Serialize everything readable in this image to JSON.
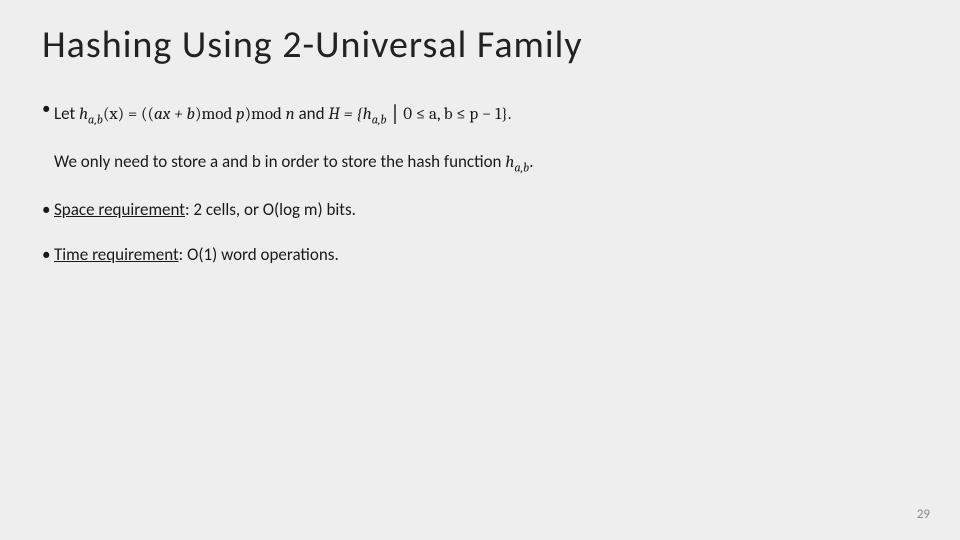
{
  "title": "Hashing Using 2-Universal Family",
  "bullet_char": "•",
  "line1": {
    "let": "Let ",
    "h_fn": "h",
    "h_sub": "a,b",
    "x_open": "(x) = ",
    "big_open": "(",
    "inner_open": "(",
    "ax_b": "ax + b",
    "inner_close": ")",
    "mod1": "mod ",
    "p": "p",
    "big_close": ")",
    "mod2": "mod ",
    "n": "n",
    "and_text": " and ",
    "H_eq": "H = {",
    "h_fn2": "h",
    "h_sub2": "a,b",
    "bar": " | ",
    "range": "0 ≤ a, b ≤ p − 1",
    "close_brace": "}.",
    "store_text": "We only need to store a and b in order to store the hash function ",
    "h_fn3": "h",
    "h_sub3": "a,b",
    "dot": "."
  },
  "space_req_label": "Space requirement",
  "space_req_text": ": 2 cells, or O(log m) bits.",
  "time_req_label": "Time requirement",
  "time_req_text": ": O(1) word operations.",
  "page_number": "29"
}
